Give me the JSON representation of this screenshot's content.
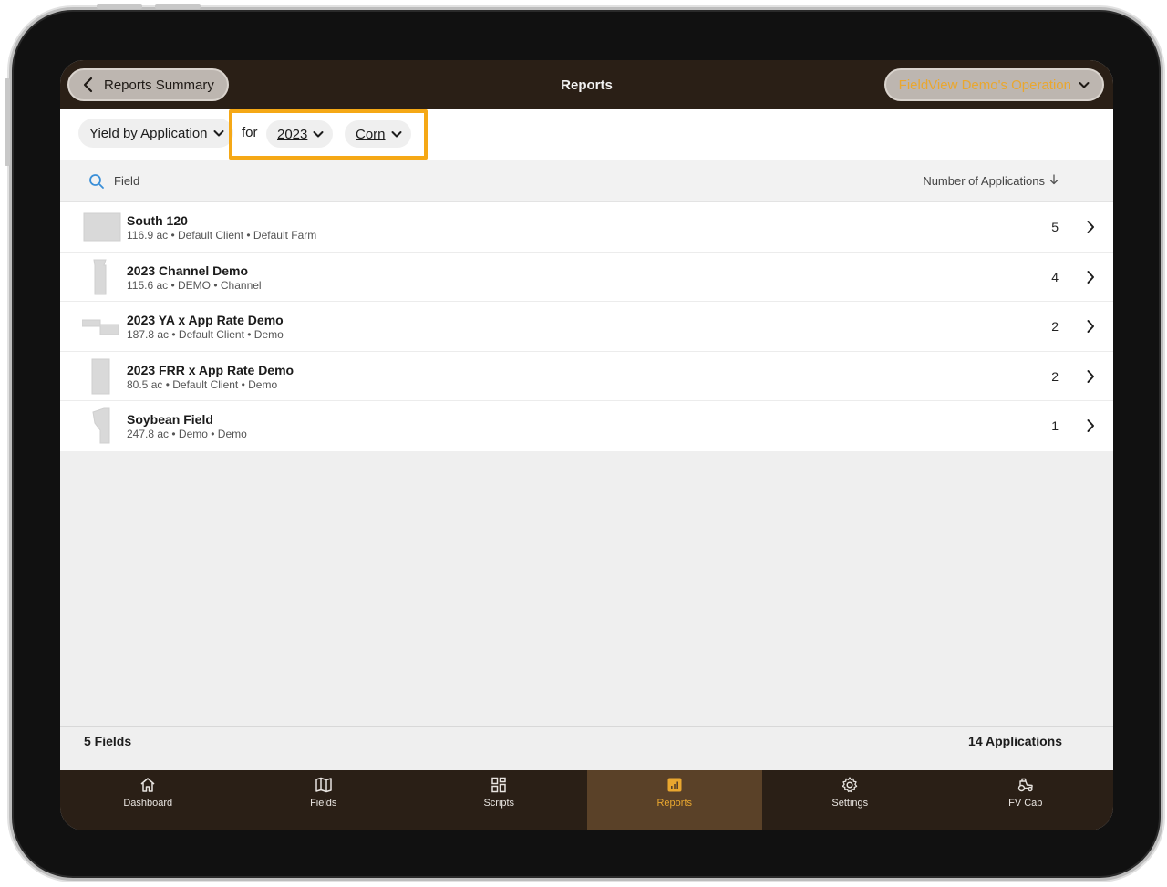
{
  "header": {
    "back_label": "Reports Summary",
    "title": "Reports",
    "operation_label": "FieldView Demo's Operation"
  },
  "filters": {
    "report_type": "Yield by Application",
    "for_label": "for",
    "year": "2023",
    "crop": "Corn",
    "highlight_color": "#f5a816"
  },
  "columns": {
    "field": "Field",
    "applications": "Number of Applications"
  },
  "fields": [
    {
      "name": "South 120",
      "details": "116.9 ac • Default Client • Default Farm",
      "count": "5"
    },
    {
      "name": "2023 Channel Demo",
      "details": "115.6 ac • DEMO • Channel",
      "count": "4"
    },
    {
      "name": "2023 YA x App Rate Demo",
      "details": "187.8 ac • Default Client • Demo",
      "count": "2"
    },
    {
      "name": "2023 FRR x App Rate Demo",
      "details": "80.5 ac • Default Client • Demo",
      "count": "2"
    },
    {
      "name": "Soybean Field",
      "details": "247.8 ac • Demo • Demo",
      "count": "1"
    }
  ],
  "summary": {
    "fields": "5 Fields",
    "applications": "14 Applications"
  },
  "tabs": [
    {
      "label": "Dashboard",
      "icon": "home-icon"
    },
    {
      "label": "Fields",
      "icon": "map-icon"
    },
    {
      "label": "Scripts",
      "icon": "grid-icon"
    },
    {
      "label": "Reports",
      "icon": "chart-icon",
      "active": true
    },
    {
      "label": "Settings",
      "icon": "gear-icon"
    },
    {
      "label": "FV Cab",
      "icon": "tractor-icon"
    }
  ],
  "colors": {
    "header_bg": "#2a1f16",
    "accent": "#e9a72f",
    "active_tab_bg": "#5a4128"
  }
}
